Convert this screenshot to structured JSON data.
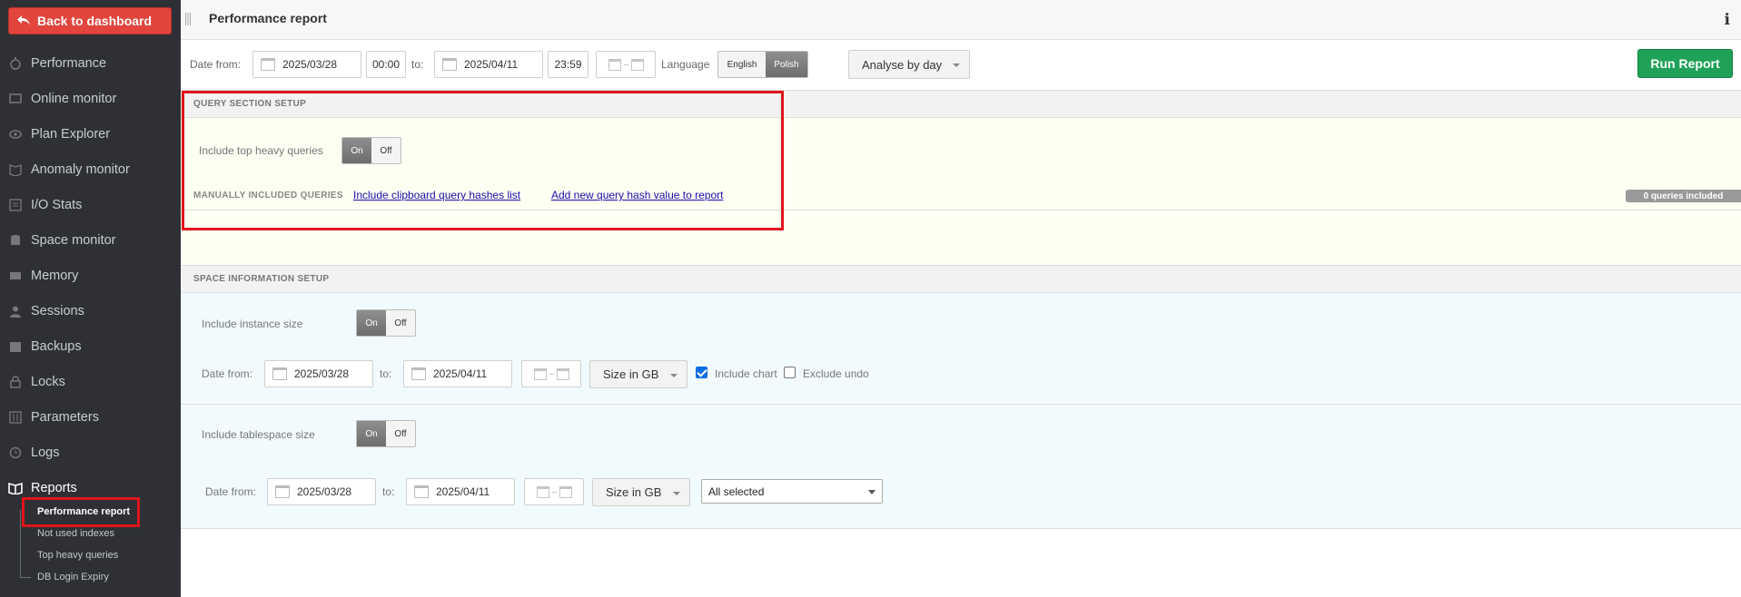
{
  "sidebar": {
    "back_label": "Back to dashboard",
    "items": [
      {
        "label": "Performance",
        "icon": "stopwatch-icon"
      },
      {
        "label": "Online monitor",
        "icon": "monitor-icon"
      },
      {
        "label": "Plan Explorer",
        "icon": "eye-icon"
      },
      {
        "label": "Anomaly monitor",
        "icon": "book-icon"
      },
      {
        "label": "I/O Stats",
        "icon": "list-icon"
      },
      {
        "label": "Space monitor",
        "icon": "database-icon"
      },
      {
        "label": "Memory",
        "icon": "memory-icon"
      },
      {
        "label": "Sessions",
        "icon": "user-icon"
      },
      {
        "label": "Backups",
        "icon": "backup-icon"
      },
      {
        "label": "Locks",
        "icon": "lock-icon"
      },
      {
        "label": "Parameters",
        "icon": "sliders-icon"
      },
      {
        "label": "Logs",
        "icon": "clock-icon"
      },
      {
        "label": "Reports",
        "icon": "open-book-icon"
      }
    ],
    "sub_items": [
      "Performance report",
      "Not used indexes",
      "Top heavy queries",
      "DB Login Expiry"
    ]
  },
  "header": {
    "title": "Performance report",
    "info_icon": "ℹ"
  },
  "filters": {
    "date_from_label": "Date from:",
    "date_from": "2025/03/28",
    "time_from": "00:00",
    "to_label": "to:",
    "date_to": "2025/04/11",
    "time_to": "23:59",
    "language_label": "Language",
    "languages": [
      "English",
      "Polish"
    ],
    "language_selected": "Polish",
    "analyse_by": "Analyse by day",
    "run_label": "Run Report"
  },
  "query_section": {
    "title": "QUERY SECTION SETUP",
    "include_top_heavy_label": "Include top heavy queries",
    "toggle_on": "On",
    "toggle_off": "Off",
    "include_top_heavy": "On",
    "manual_label": "MANUALLY INCLUDED QUERIES",
    "link_clipboard": "Include clipboard query hashes list",
    "link_add": "Add new query hash value to report",
    "badge": "0 queries included"
  },
  "space_section": {
    "title": "SPACE INFORMATION SETUP",
    "instance_label": "Include instance size",
    "instance_toggle": "On",
    "date_from_label": "Date from:",
    "to_label": "to:",
    "date_from": "2025/03/28",
    "date_to": "2025/04/11",
    "size_unit": "Size in GB",
    "include_chart_label": "Include chart",
    "include_chart": true,
    "exclude_undo_label": "Exclude undo",
    "exclude_undo": false,
    "tablespace_label": "Include tablespace size",
    "tablespace_toggle": "On",
    "ts_date_from": "2025/03/28",
    "ts_date_to": "2025/04/11",
    "ts_size_unit": "Size in GB",
    "ts_select": "All selected"
  },
  "colors": {
    "sidebar_bg": "#2e3035",
    "back_button": "#e2453c",
    "run_button": "#1fa257",
    "highlight": "#e0141b",
    "query_bg": "#fffef3",
    "space_bg": "#f1fbfd"
  }
}
